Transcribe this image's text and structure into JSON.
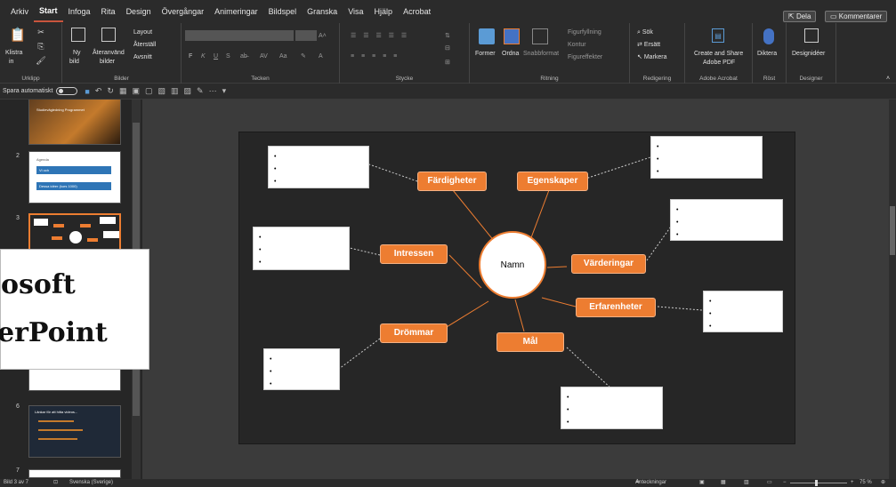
{
  "tabs": [
    "Arkiv",
    "Start",
    "Infoga",
    "Rita",
    "Design",
    "Övergångar",
    "Animeringar",
    "Bildspel",
    "Granska",
    "Visa",
    "Hjälp",
    "Acrobat"
  ],
  "active_tab": "Start",
  "share_label": "Dela",
  "comments_label": "Kommentarer",
  "ribbon": {
    "clipboard": {
      "paste": "Klistra",
      "paste2": "in",
      "group": "Urklipp"
    },
    "slides": {
      "new": "Ny",
      "new2": "bild",
      "reuse": "Återanvänd",
      "reuse2": "bilder",
      "layout": "Layout",
      "reset": "Återställ",
      "section": "Avsnitt",
      "group": "Bilder"
    },
    "font": {
      "bold": "F",
      "italic": "K",
      "underline": "U",
      "strike": "S",
      "group": "Tecken"
    },
    "paragraph": {
      "group": "Stycke"
    },
    "drawing": {
      "shapes": "Former",
      "arrange": "Ordna",
      "quick": "Snabbformat",
      "fill": "Figurfyllning",
      "outline": "Kontur",
      "effects": "Figureffekter",
      "group": "Ritning"
    },
    "editing": {
      "find": "Sök",
      "replace": "Ersätt",
      "select": "Markera",
      "group": "Redigering"
    },
    "acrobat": {
      "create": "Create and Share",
      "create2": "Adobe PDF",
      "group": "Adobe Acrobat"
    },
    "voice": {
      "dictate": "Diktera",
      "group": "Röst"
    },
    "designer": {
      "ideas": "Designidéer",
      "group": "Designer"
    }
  },
  "qat": {
    "autosave": "Spara automatiskt"
  },
  "slides": [
    {
      "num": "",
      "title": "Studievägledning Programmet"
    },
    {
      "num": "2",
      "title": "Agenda",
      "item1": "Vi och",
      "item2": "Dessa idéer (kurs 1000)"
    },
    {
      "num": "3"
    },
    {
      "num": "6",
      "title": "Länkar för att hitta videos..."
    },
    {
      "num": "7"
    }
  ],
  "mindmap": {
    "center": "Namn",
    "nodes": {
      "fardigheter": "Färdigheter",
      "egenskaper": "Egenskaper",
      "intressen": "Intressen",
      "varderingar": "Värderingar",
      "erfarenheter": "Erfarenheter",
      "drommar": "Drömmar",
      "mal": "Mål"
    },
    "bullet": "•"
  },
  "overlay": {
    "line1": "osoft",
    "line2": "erPoint"
  },
  "status": {
    "slide": "Bild 3 av 7",
    "lang": "Svenska (Sverige)",
    "notes": "Anteckningar",
    "zoom": "75 %"
  },
  "colors": {
    "accent": "#ed7d31",
    "slide_bg": "#262626",
    "tab_underline": "#c8553d"
  }
}
